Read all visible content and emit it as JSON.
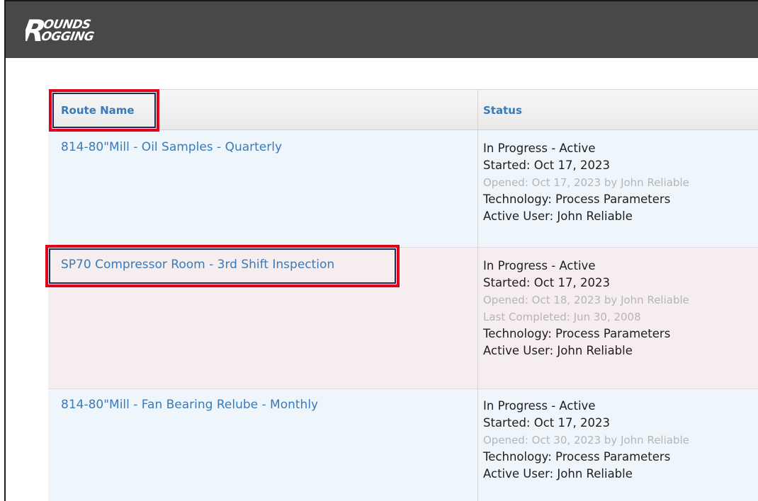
{
  "app": {
    "logo_text": "ROUNDS LOGGING",
    "colors": {
      "topbar": "#484848",
      "link": "#3a7ab8",
      "highlight": "#e0001b"
    }
  },
  "table": {
    "headers": {
      "route_name": "Route Name",
      "status": "Status"
    },
    "rows": [
      {
        "route": "814-80\"Mill - Oil Samples - Quarterly",
        "status_line": "In Progress - Active",
        "started": "Started: Oct 17, 2023",
        "opened": "Opened: Oct 17, 2023 by John Reliable",
        "last_completed": "",
        "technology": "Technology: Process Parameters",
        "active_user": "Active User: John Reliable"
      },
      {
        "route": "SP70 Compressor Room - 3rd Shift Inspection",
        "status_line": "In Progress - Active",
        "started": "Started: Oct 17, 2023",
        "opened": "Opened: Oct 18, 2023 by John Reliable",
        "last_completed": "Last Completed: Jun 30, 2008",
        "technology": "Technology: Process Parameters",
        "active_user": "Active User: John Reliable"
      },
      {
        "route": "814-80\"Mill - Fan Bearing Relube - Monthly",
        "status_line": "In Progress - Active",
        "started": "Started: Oct 17, 2023",
        "opened": "Opened: Oct 30, 2023 by John Reliable",
        "last_completed": "",
        "technology": "Technology: Process Parameters",
        "active_user": "Active User: John Reliable"
      }
    ]
  }
}
